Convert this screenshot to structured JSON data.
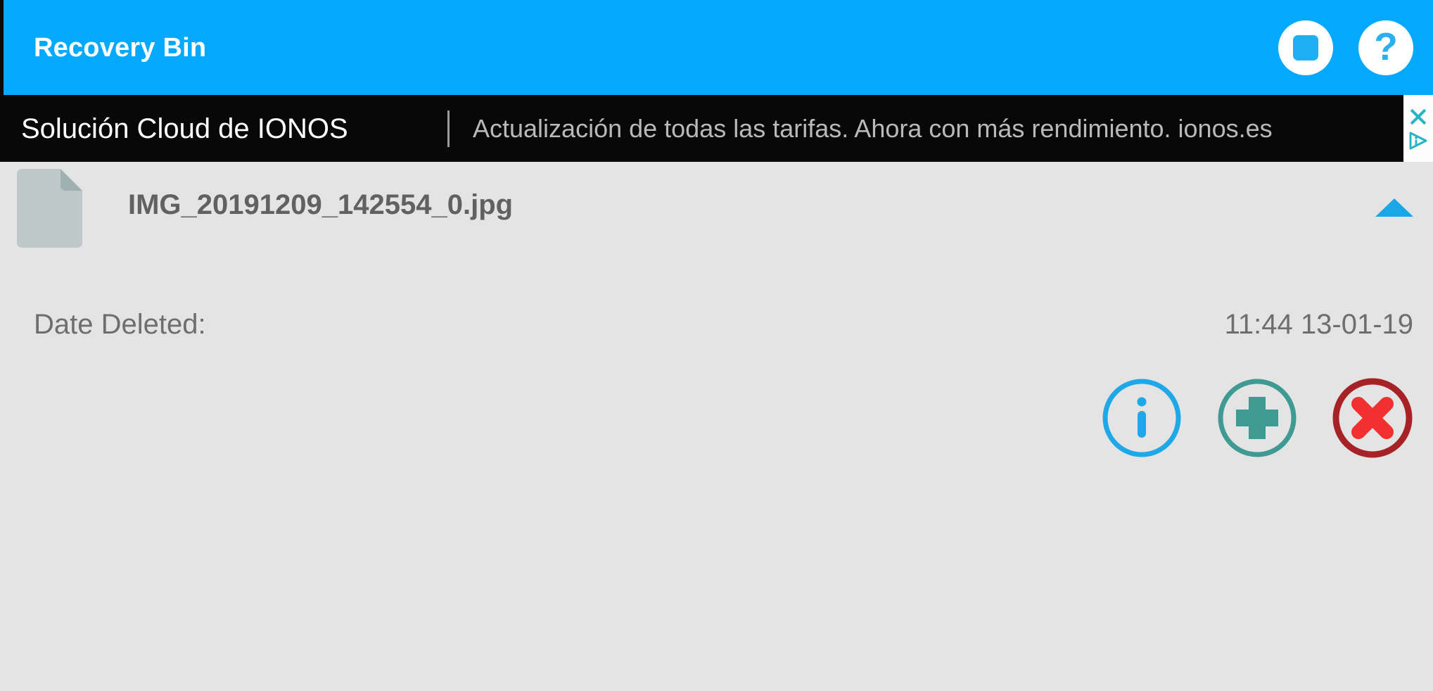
{
  "titlebar": {
    "title": "Recovery Bin",
    "background_color": "#02a9fc",
    "actions": [
      {
        "name": "stop-button",
        "icon": "stop-square-icon",
        "label": "Stop"
      },
      {
        "name": "help-button",
        "icon": "question-mark-icon",
        "label": "?"
      }
    ]
  },
  "ad": {
    "headline": "Solución Cloud de IONOS",
    "body": "Actualización de todas las tarifas. Ahora con más rendimiento. ionos.es",
    "close_icon": "close-x-icon",
    "adchoices_icon": "adchoices-icon",
    "background_color": "#080808",
    "accent_color": "#27b5c6"
  },
  "file": {
    "name": "IMG_20191209_142554_0.jpg",
    "icon": "document-file-icon",
    "expanded": true,
    "expand_icon": "triangle-up-icon",
    "expand_color": "#1aa7e8"
  },
  "details": {
    "date_deleted_label": "Date Deleted:",
    "date_deleted_value": "11:44 13-01-19"
  },
  "actions": [
    {
      "name": "info-button",
      "icon": "info-circle-icon",
      "label": "Info",
      "color": "#1fa8e8"
    },
    {
      "name": "restore-button",
      "icon": "plus-circle-icon",
      "label": "Restore",
      "color": "#3f9a93"
    },
    {
      "name": "delete-button",
      "icon": "delete-x-circle-icon",
      "label": "Delete",
      "color": "#a62226"
    }
  ],
  "theme": {
    "body_background": "#e4e4e4",
    "text_primary": "#616161",
    "text_secondary": "#6e6e6e"
  }
}
